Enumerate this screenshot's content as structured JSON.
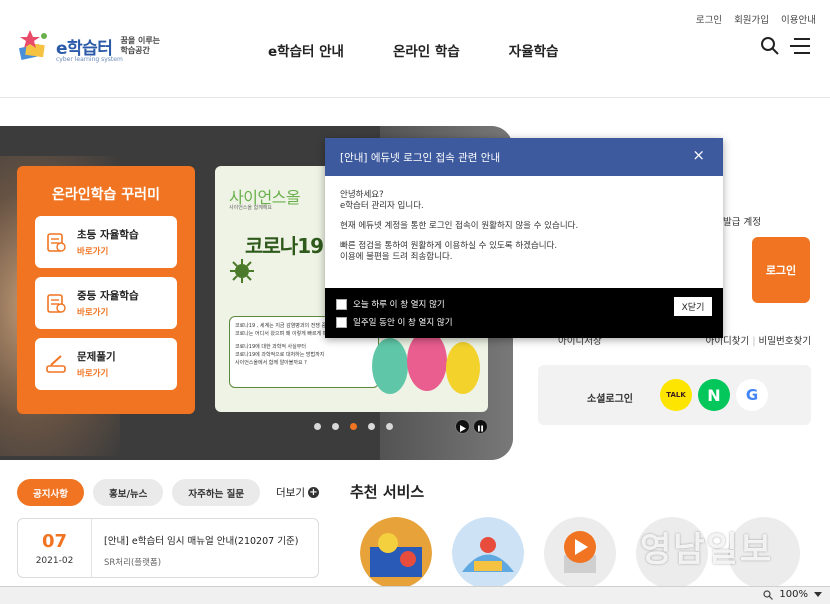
{
  "header": {
    "utility_links": [
      "로그인",
      "회원가입",
      "이용안내"
    ],
    "logo_text": "e학습터",
    "logo_sub": "cyber learning system",
    "logo_slogan_1": "꿈을 이루는",
    "logo_slogan_2": "학습공간",
    "nav": [
      "e학습터 안내",
      "온라인 학습",
      "자율학습"
    ]
  },
  "hero": {
    "box_title": "온라인학습 꾸러미",
    "quick_links": [
      {
        "title": "초등 자율학습",
        "sub": "바로가기"
      },
      {
        "title": "중등 자율학습",
        "sub": "바로가기"
      },
      {
        "title": "문제풀기",
        "sub": "바로가기"
      }
    ],
    "banner": {
      "head": "사이언스올",
      "sub": "사이언스올 함께해요",
      "big": "코로나19 과",
      "note_lines": [
        "코로나19 , 세계는 지금 감염병과의 전쟁 중",
        "코로나는 어디서 왔으며 왜 이렇게 빠르게 퍼졌을까?",
        "코로나19에 대한 과학적 사실부터",
        "코로나19에 과학적으로 대처하는 방법까지",
        "사이언스올에서 함께 알아볼까요 ?"
      ]
    },
    "slides": 5,
    "active_slide": 3
  },
  "login_side": {
    "label": "발급 계정",
    "login_button": "로그인",
    "save_id": "아이디저장",
    "find_id": "아이디찾기",
    "find_pw": "비밀번호찾기",
    "social_label": "소셜로그인",
    "kakao_label": "TALK",
    "naver_label": "N",
    "google_label": "G"
  },
  "notice": {
    "tabs": [
      "공지사항",
      "홍보/뉴스",
      "자주하는 질문"
    ],
    "more": "더보기",
    "item": {
      "day": "07",
      "year_month": "2021-02",
      "title": "[안내] e학습터 임시 매뉴얼 안내(210207 기준)",
      "writer": "SR처리(플랫폼)"
    }
  },
  "recommend": {
    "title": "추천 서비스"
  },
  "watermark": "영남일보",
  "modal": {
    "title": "[안내] 에듀넷 로그인 접속 관련 안내",
    "close": "×",
    "lines": [
      "안녕하세요?",
      "e학습터 관리자 입니다.",
      "현재 에듀넷 계정을 통한 로그인 접속이 원활하지 않을 수 있습니다.",
      "빠른 점검을 통하여 원활하게 이용하실 수 있도록 하겠습니다.",
      "이용에 불편을 드려 죄송합니다."
    ],
    "check_today": "오늘 하루 이 창 열지 않기",
    "check_week": "일주일 동안 이 창 열지 않기",
    "close_button": "X닫기"
  },
  "status": {
    "zoom": "100%"
  },
  "colors": {
    "accent": "#f07421",
    "modal_header": "#3d5a9e"
  }
}
